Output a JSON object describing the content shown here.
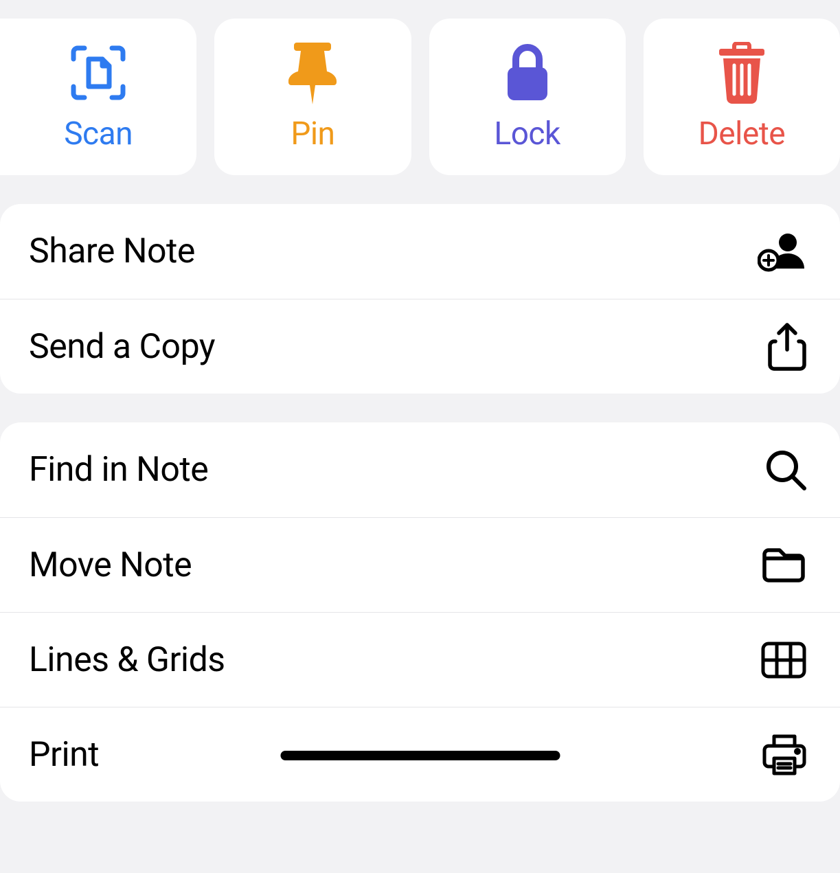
{
  "actions": {
    "scan": {
      "label": "Scan",
      "color": "#2e7bf0"
    },
    "pin": {
      "label": "Pin",
      "color": "#f09a1a"
    },
    "lock": {
      "label": "Lock",
      "color": "#5a56d6"
    },
    "delete": {
      "label": "Delete",
      "color": "#e85449"
    }
  },
  "group1": {
    "share": {
      "label": "Share Note"
    },
    "send": {
      "label": "Send a Copy"
    }
  },
  "group2": {
    "find": {
      "label": "Find in Note"
    },
    "move": {
      "label": "Move Note"
    },
    "lines": {
      "label": "Lines & Grids"
    },
    "print": {
      "label": "Print"
    }
  }
}
